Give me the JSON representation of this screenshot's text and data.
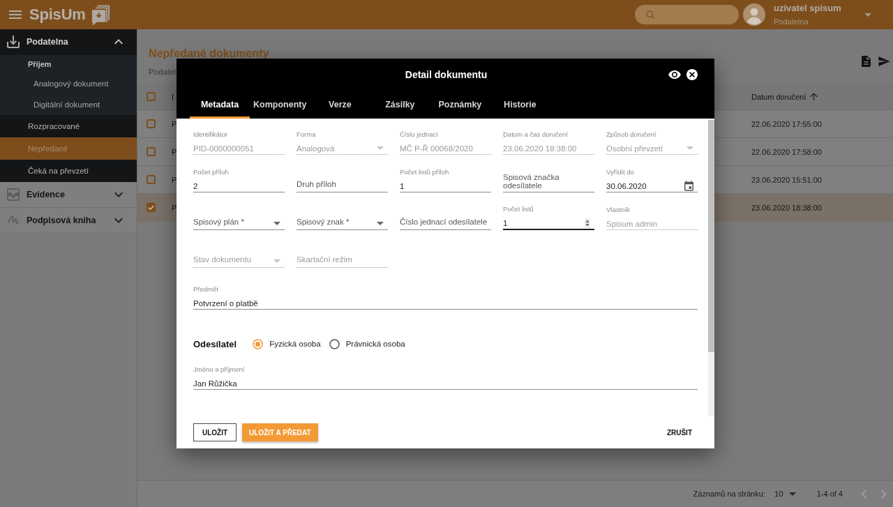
{
  "app_bar": {
    "app_name": "SpisUm",
    "user": {
      "name": "uzivatel spisum",
      "role": "Podatelna"
    }
  },
  "sidebar": {
    "groups": [
      {
        "label": "Podatelna",
        "expanded": true,
        "children": [
          {
            "label": "Příjem",
            "selected": false,
            "children": [
              {
                "label": "Analogový dokument",
                "selected": false
              },
              {
                "label": "Digitální dokument",
                "selected": false
              }
            ]
          },
          {
            "label": "Rozpracované",
            "selected": false
          },
          {
            "label": "Nepředané",
            "selected": true
          },
          {
            "label": "Čeká na převzetí",
            "selected": false
          }
        ]
      },
      {
        "label": "Evidence",
        "expanded": false
      },
      {
        "label": "Podpisová kniha",
        "expanded": false
      }
    ]
  },
  "page": {
    "title": "Nepředané dokumenty",
    "breadcrumb": "Podatel"
  },
  "table": {
    "all_selected": false,
    "columns": [
      {
        "label": "I",
        "sorted": false
      },
      {
        "label": "Datum doručení",
        "sorted": true
      }
    ],
    "rows": [
      {
        "column_1": "P",
        "date": "22.06.2020 17:55:00",
        "selected": false
      },
      {
        "column_1": "P",
        "date": "22.06.2020 17:58:00",
        "selected": false
      },
      {
        "column_1": "P",
        "date": "23.06.2020 15:51:00",
        "selected": false
      },
      {
        "column_1": "P",
        "date": "23.06.2020 18:38:00",
        "selected": true
      }
    ]
  },
  "pagination": {
    "rows_per_page_label": "Záznamů na stránku:",
    "rows_per_page": "10",
    "range": "1-4 of 4",
    "buttons": [
      {
        "kind": "prev",
        "disabled": true
      },
      {
        "kind": "next",
        "disabled": true
      }
    ]
  },
  "modal": {
    "title": "Detail dokumentu",
    "tabs": [
      {
        "label": "Metadata",
        "selected": true
      },
      {
        "label": "Komponenty",
        "selected": false
      },
      {
        "label": "Verze",
        "selected": false
      },
      {
        "label": "Zásilky",
        "selected": false
      },
      {
        "label": "Poznámky",
        "selected": false
      },
      {
        "label": "Historie",
        "selected": false
      }
    ],
    "field_rows": [
      {
        "fields": [
          {
            "kind": "text",
            "label": "Identifikátor",
            "value": "PID-0000000051",
            "disabled": true,
            "focused": false
          },
          {
            "kind": "select",
            "label": "Forma",
            "value": "Analogová",
            "disabled": true,
            "focused": false
          },
          {
            "kind": "text",
            "label": "Číslo jednací",
            "value": "MČ P-Ř 00068/2020",
            "disabled": true,
            "focused": false
          },
          {
            "kind": "text",
            "label": "Datum a čas doručení",
            "value": "23.06.2020 18:38:00",
            "disabled": true,
            "focused": false
          },
          {
            "kind": "select",
            "label": "Způsob doručení",
            "value": "Osobní převzetí",
            "disabled": true,
            "focused": false
          }
        ]
      },
      {
        "fields": [
          {
            "kind": "text",
            "label": "Počet příloh",
            "value": "2",
            "disabled": false,
            "focused": false
          },
          {
            "kind": "text",
            "label": "Druh příloh",
            "disabled": false,
            "focused": false
          },
          {
            "kind": "text",
            "label": "Počet listů příloh",
            "value": "1",
            "disabled": false,
            "focused": false
          },
          {
            "kind": "text",
            "label": "Spisová značka odesílatele",
            "disabled": false,
            "focused": false
          },
          {
            "kind": "date",
            "label": "Vyřídit do",
            "value": "30.06.2020",
            "disabled": false,
            "focused": false
          }
        ]
      },
      {
        "fields": [
          {
            "kind": "select",
            "label": "Spisový plán *",
            "disabled": false,
            "focused": false
          },
          {
            "kind": "select",
            "label": "Spisový znak *",
            "disabled": false,
            "focused": false
          },
          {
            "kind": "text",
            "label": "Číslo jednací odesílatele",
            "disabled": false,
            "focused": false
          },
          {
            "kind": "number",
            "label": "Počet listů",
            "value": "1",
            "disabled": false,
            "focused": true
          },
          {
            "kind": "text",
            "label": "Vlastník",
            "value": "Spisum admin",
            "disabled": true,
            "focused": false
          }
        ]
      },
      {
        "fields": [
          {
            "kind": "select",
            "label": "Stav dokumentu",
            "disabled": true,
            "focused": false
          },
          {
            "kind": "text",
            "label": "Skartační režim",
            "disabled": true,
            "focused": false
          }
        ]
      }
    ],
    "subject": {
      "label": "Předmět",
      "value": "Potvrzení o platbě",
      "disabled": false,
      "focused": false
    },
    "sender": {
      "title": "Odesílatel",
      "options": [
        {
          "label": "Fyzická osoba",
          "selected": true
        },
        {
          "label": "Právnická osoba",
          "selected": false
        }
      ],
      "name_field": {
        "label": "Jméno a příjmení",
        "value": "Jan Růžička",
        "disabled": false,
        "focused": false
      }
    },
    "actions": [
      {
        "kind": "outlined",
        "label": "ULOŽIT"
      },
      {
        "kind": "primary",
        "label": "ULOŽIT A PŘEDAT"
      },
      {
        "kind": "text",
        "label": "ZRUŠIT"
      }
    ]
  }
}
